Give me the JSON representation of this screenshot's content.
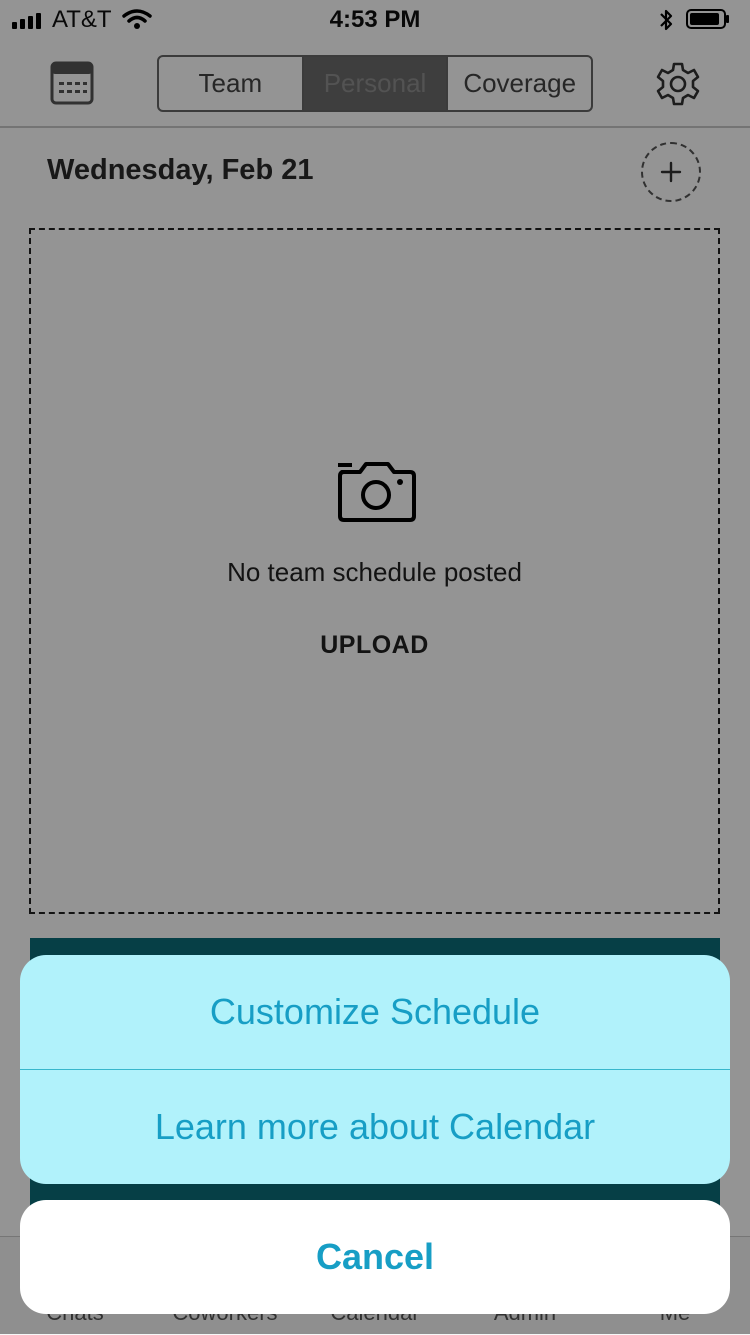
{
  "status_bar": {
    "carrier": "AT&T",
    "time": "4:53 PM"
  },
  "nav": {
    "segments": [
      "Team",
      "Personal",
      "Coverage"
    ],
    "active_segment": "Personal",
    "icons": {
      "left": "calendar-icon",
      "right": "gear-icon"
    }
  },
  "content": {
    "date": "Wednesday, Feb 21",
    "empty_message": "No team schedule posted",
    "upload_label": "UPLOAD"
  },
  "tab_bar": {
    "items": [
      "Chats",
      "Coworkers",
      "Calendar",
      "Admin",
      "Me"
    ]
  },
  "action_sheet": {
    "options": [
      "Customize Schedule",
      "Learn more about Calendar"
    ],
    "cancel_label": "Cancel"
  },
  "colors": {
    "action_sheet_bg": "#b1f2fb",
    "action_text": "#179ec5",
    "accent_bar": "#0b6d79"
  }
}
